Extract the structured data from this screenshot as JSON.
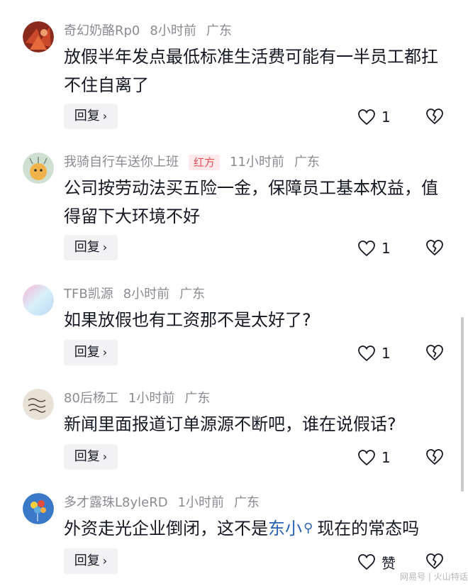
{
  "comments": [
    {
      "username": "奇幻奶酪Rp0",
      "badge": "",
      "time": "8小时前",
      "location": "广东",
      "text_before": "放假半年发点最低标准生活费可能有一半员工都扛不住自离了",
      "link": "",
      "text_after": "",
      "reply_label": "回复",
      "like_count": "1"
    },
    {
      "username": "我骑自行车送你上班",
      "badge": "红方",
      "time": "11小时前",
      "location": "广东",
      "text_before": "公司按劳动法买五险一金，保障员工基本权益，值得留下大环境不好",
      "link": "",
      "text_after": "",
      "reply_label": "回复",
      "like_count": "1"
    },
    {
      "username": "TFB凯源",
      "badge": "",
      "time": "8小时前",
      "location": "广东",
      "text_before": "如果放假也有工资那不是太好了?",
      "link": "",
      "text_after": "",
      "reply_label": "回复",
      "like_count": "1"
    },
    {
      "username": "80后杨工",
      "badge": "",
      "time": "1小时前",
      "location": "广东",
      "text_before": "新闻里面报道订单源源不断吧，谁在说假话?",
      "link": "",
      "text_after": "",
      "reply_label": "回复",
      "like_count": "1"
    },
    {
      "username": "多才露珠L8yleRD",
      "badge": "",
      "time": "1小时前",
      "location": "广东",
      "text_before": "外资走光企业倒闭，这不是",
      "link": "东小",
      "text_after": "现在的常态吗",
      "reply_label": "回复",
      "like_count": "赞"
    }
  ],
  "icons": {
    "like": "heart-outline-icon",
    "dislike": "broken-heart-icon",
    "reply_chevron": "chevron-right-icon",
    "search": "search-icon"
  },
  "colors": {
    "meta": "#8a8b91",
    "link": "#2a63b8",
    "badge_bg": "#fde9ea",
    "badge_text": "#e0505b"
  },
  "watermark": "网易号 | 火山特话"
}
